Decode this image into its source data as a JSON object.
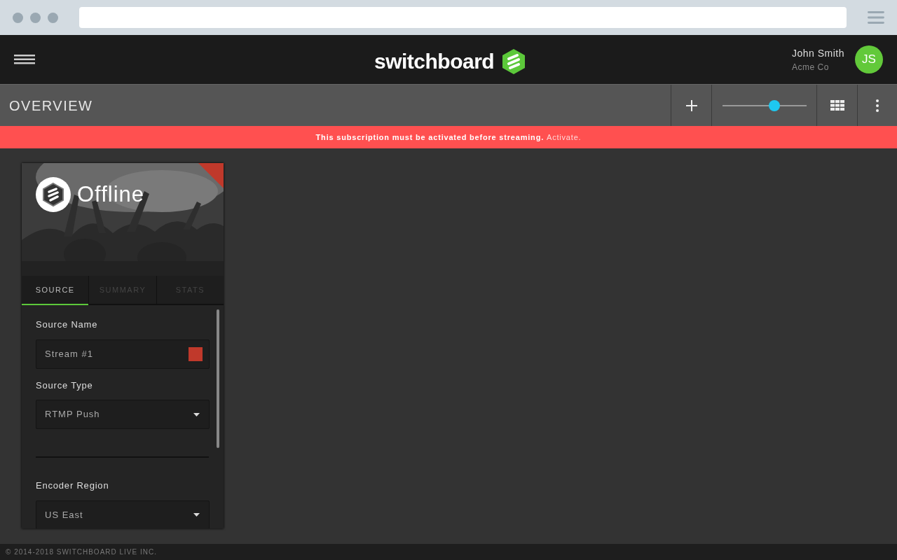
{
  "header": {
    "logo": "switchboard",
    "user_name": "John Smith",
    "company": "Acme Co",
    "initials": "JS"
  },
  "toolbar": {
    "title": "OVERVIEW",
    "zoom_slider": {
      "level": 0.62
    }
  },
  "banner": {
    "message": "This subscription must be activated before streaming.",
    "link": "Activate."
  },
  "card": {
    "status": "Offline",
    "tabs": [
      {
        "label": "SOURCE",
        "selected": true
      },
      {
        "label": "SUMMARY",
        "selected": false
      },
      {
        "label": "STATS",
        "selected": false
      }
    ],
    "fields": [
      {
        "label": "Source Name",
        "kind": "text",
        "value": "Stream #1"
      },
      {
        "label": "Source Type",
        "kind": "select",
        "value": "RTMP Push"
      },
      {
        "kind": "divider"
      },
      {
        "label": "Encoder Region",
        "kind": "select",
        "value": "US East"
      }
    ]
  },
  "footer": "© 2014-2018 SWITCHBOARD LIVE INC."
}
